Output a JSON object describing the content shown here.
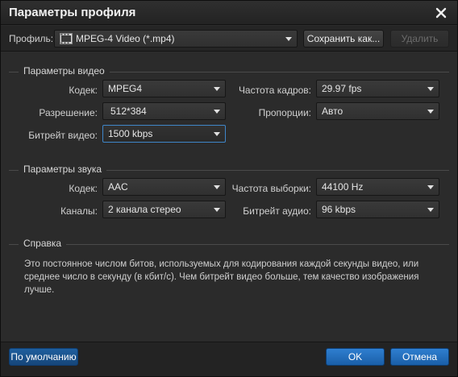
{
  "window": {
    "title": "Параметры профиля"
  },
  "toolbar": {
    "profile_label": "Профиль:",
    "profile_value": "MPEG-4 Video (*.mp4)",
    "save_as_label": "Сохранить как...",
    "delete_label": "Удалить"
  },
  "video": {
    "section_title": "Параметры видео",
    "codec_label": "Кодек:",
    "codec_value": "MPEG4",
    "framerate_label": "Частота кадров:",
    "framerate_value": "29.97 fps",
    "resolution_label": "Разрешение:",
    "resolution_value": "512*384",
    "aspect_label": "Пропорции:",
    "aspect_value": "Авто",
    "bitrate_label": "Битрейт видео:",
    "bitrate_value": "1500 kbps"
  },
  "audio": {
    "section_title": "Параметры звука",
    "codec_label": "Кодек:",
    "codec_value": "AAC",
    "samplerate_label": "Частота выборки:",
    "samplerate_value": "44100 Hz",
    "channels_label": "Каналы:",
    "channels_value": "2 канала стерео",
    "bitrate_label": "Битрейт аудио:",
    "bitrate_value": "96 kbps"
  },
  "help": {
    "section_title": "Справка",
    "text": "Это постоянное числом битов, используемых для кодирования каждой секунды видео, или среднее число в секунду (в кбит/с). Чем битрейт видео больше, тем качество изображения лучше."
  },
  "footer": {
    "default_label": "По умолчанию",
    "ok_label": "OK",
    "cancel_label": "Отмена"
  },
  "colors": {
    "accent": "#2f7fd0",
    "background": "#2b2b2b",
    "focus_border": "#3f86c9"
  },
  "icons": {
    "close": "close-icon",
    "profile_format": "mpeg-film-icon",
    "dropdown": "chevron-down-icon"
  }
}
